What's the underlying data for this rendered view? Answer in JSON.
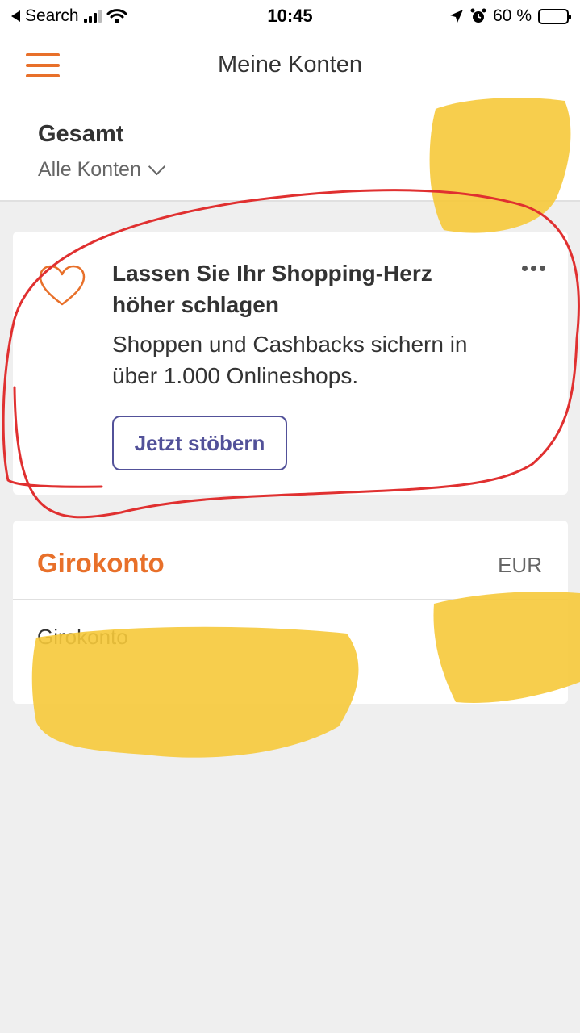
{
  "status_bar": {
    "back_label": "Search",
    "time": "10:45",
    "battery": "60 %",
    "battery_level": 0.6
  },
  "header": {
    "title": "Meine Konten",
    "menu_icon": "hamburger-icon"
  },
  "summary": {
    "title": "Gesamt",
    "filter_label": "Alle Konten",
    "filter_icon": "chevron-down-icon"
  },
  "promo": {
    "icon": "heart-icon",
    "title": "Lassen Sie Ihr Shopping-Herz höher schlagen",
    "text": "Shoppen und Cashbacks sichern in über 1.000 Onlineshops.",
    "button_label": "Jetzt stöbern",
    "more_icon": "more-icon"
  },
  "account": {
    "title": "Girokonto",
    "currency": "EUR",
    "rows": [
      {
        "name": "Girokonto"
      }
    ]
  },
  "colors": {
    "accent": "#e8702a",
    "button": "#525199",
    "background": "#efefef",
    "annotation": "#e03030",
    "redaction": "#f6c93a"
  }
}
